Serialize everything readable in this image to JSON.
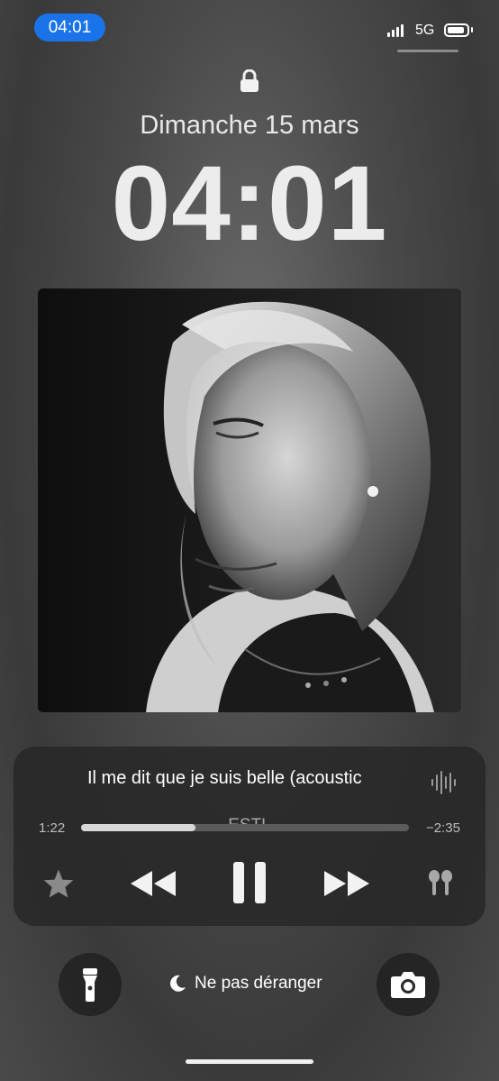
{
  "status_bar": {
    "time": "04:01",
    "network": "5G"
  },
  "lockscreen": {
    "date": "Dimanche 15 mars",
    "time": "04:01"
  },
  "player": {
    "title": "Il me dit que je suis belle (acoustic",
    "artist": "ESTL",
    "elapsed": "1:22",
    "remaining": "−2:35",
    "progress": 0.35
  },
  "bottom": {
    "dnd_label": "Ne pas déranger"
  },
  "icons": [
    "lock-icon",
    "star-icon",
    "rewind-icon",
    "pause-icon",
    "fast-forward-icon",
    "airpods-icon",
    "flashlight-icon",
    "moon-icon",
    "camera-icon",
    "waveform-icon"
  ]
}
